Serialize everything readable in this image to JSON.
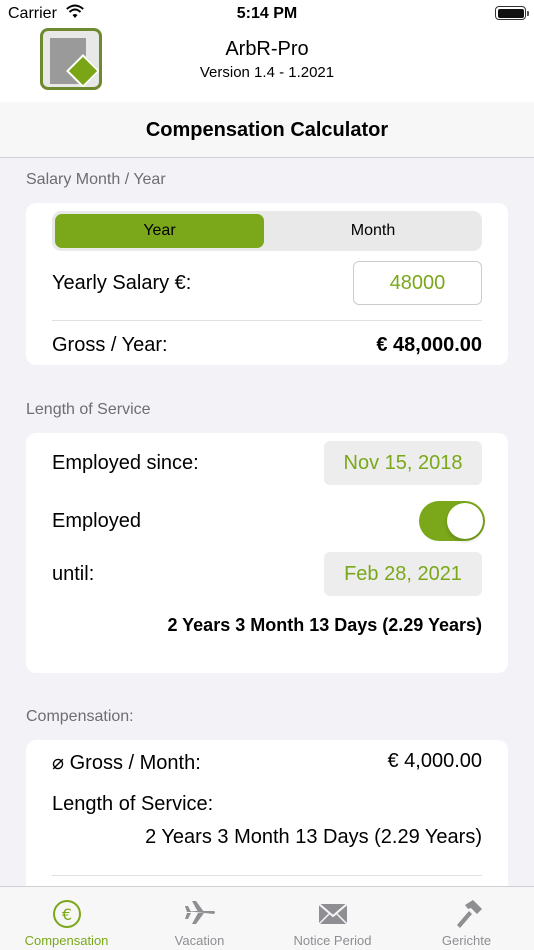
{
  "status_bar": {
    "carrier": "Carrier",
    "time": "5:14 PM"
  },
  "header": {
    "app_name": "ArbR-Pro",
    "version": "Version 1.4 - 1.2021"
  },
  "nav": {
    "title": "Compensation Calculator"
  },
  "salary_section": {
    "header": "Salary Month / Year",
    "segments": [
      "Year",
      "Month"
    ],
    "selected_segment": "Year",
    "salary_label": "Yearly Salary €:",
    "salary_value": "48000",
    "gross_label": "Gross / Year:",
    "gross_value": "€  48,000.00"
  },
  "service_section": {
    "header": "Length of Service",
    "employed_since_label": "Employed since:",
    "employed_since_value": "Nov 15, 2018",
    "employed_label": "Employed",
    "employed_toggle": true,
    "until_label": "until:",
    "until_value": "Feb 28, 2021",
    "summary": "2 Years 3 Month 13 Days (2.29 Years)"
  },
  "compensation_section": {
    "header": "Compensation:",
    "gross_month_label": "⌀ Gross / Month:",
    "gross_month_value": "€ 4,000.00",
    "length_label": "Length of Service:",
    "length_value": "2 Years 3 Month 13 Days (2.29 Years)"
  },
  "tab_bar": {
    "tabs": [
      {
        "label": "Compensation",
        "icon": "euro-circle-icon",
        "active": true
      },
      {
        "label": "Vacation",
        "icon": "airplane-icon",
        "active": false
      },
      {
        "label": "Notice Period",
        "icon": "envelope-icon",
        "active": false
      },
      {
        "label": "Gerichte",
        "icon": "hammer-icon",
        "active": false
      }
    ]
  },
  "colors": {
    "accent": "#7aa81a",
    "background": "#f2f2f7",
    "card": "#ffffff"
  }
}
